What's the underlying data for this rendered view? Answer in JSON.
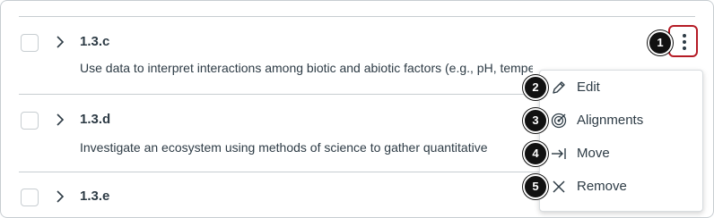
{
  "rows": [
    {
      "id": "1.3.c",
      "description": "Use data to interpret interactions among biotic and abiotic factors (e.g., pH, temperature, soil"
    },
    {
      "id": "1.3.d",
      "description": "Investigate an ecosystem using methods of science to gather quantitative"
    },
    {
      "id": "1.3.e",
      "description": ""
    }
  ],
  "menu": {
    "items": [
      {
        "label": "Edit",
        "icon": "pencil-icon"
      },
      {
        "label": "Alignments",
        "icon": "target-icon"
      },
      {
        "label": "Move",
        "icon": "move-icon"
      },
      {
        "label": "Remove",
        "icon": "x-icon"
      }
    ]
  },
  "callouts": [
    "1",
    "2",
    "3",
    "4",
    "5"
  ],
  "colors": {
    "accent": "#b51b25",
    "text": "#2d3b45",
    "border": "#c7cdd1",
    "callout": "#111111"
  }
}
